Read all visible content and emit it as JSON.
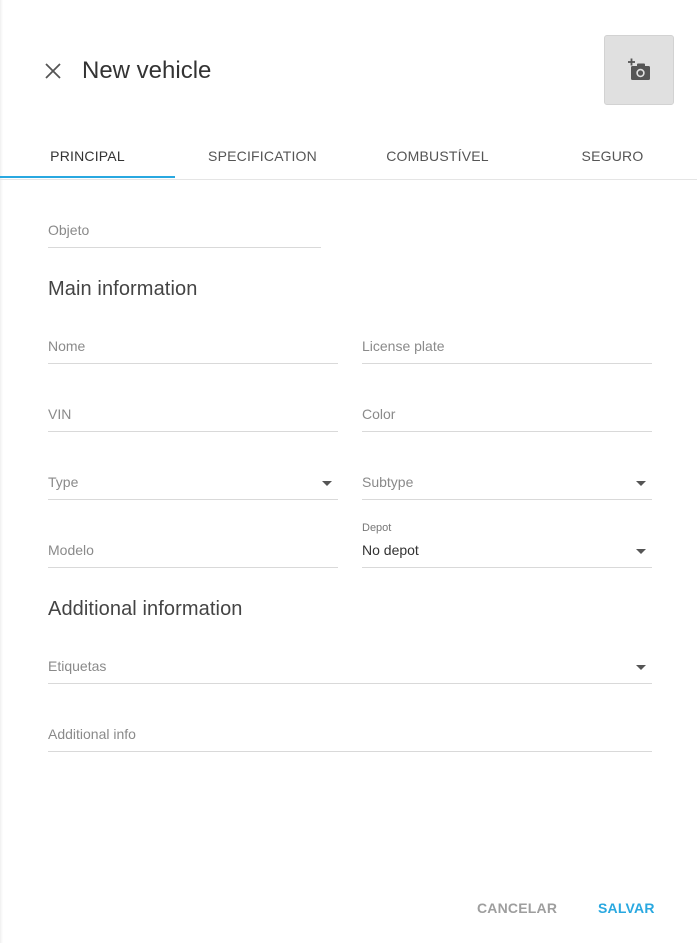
{
  "header": {
    "title": "New vehicle",
    "close_icon": "close-icon",
    "photo_icon": "add-photo-icon"
  },
  "tabs": [
    {
      "label": "PRINCIPAL",
      "active": true
    },
    {
      "label": "SPECIFICATION",
      "active": false
    },
    {
      "label": "COMBUSTÍVEL",
      "active": false
    },
    {
      "label": "SEGURO",
      "active": false
    }
  ],
  "form": {
    "objeto": {
      "placeholder": "Objeto"
    },
    "main_section": "Main information",
    "nome": {
      "placeholder": "Nome"
    },
    "license_plate": {
      "placeholder": "License plate"
    },
    "vin": {
      "placeholder": "VIN"
    },
    "color": {
      "placeholder": "Color"
    },
    "type": {
      "placeholder": "Type"
    },
    "subtype": {
      "placeholder": "Subtype"
    },
    "modelo": {
      "placeholder": "Modelo"
    },
    "depot": {
      "label": "Depot",
      "value": "No depot"
    },
    "additional_section": "Additional information",
    "etiquetas": {
      "placeholder": "Etiquetas"
    },
    "additional_info": {
      "placeholder": "Additional info"
    }
  },
  "footer": {
    "cancel_label": "CANCELAR",
    "save_label": "SALVAR"
  },
  "colors": {
    "accent": "#29a8e0",
    "photo_bg": "#e0e0e0"
  }
}
